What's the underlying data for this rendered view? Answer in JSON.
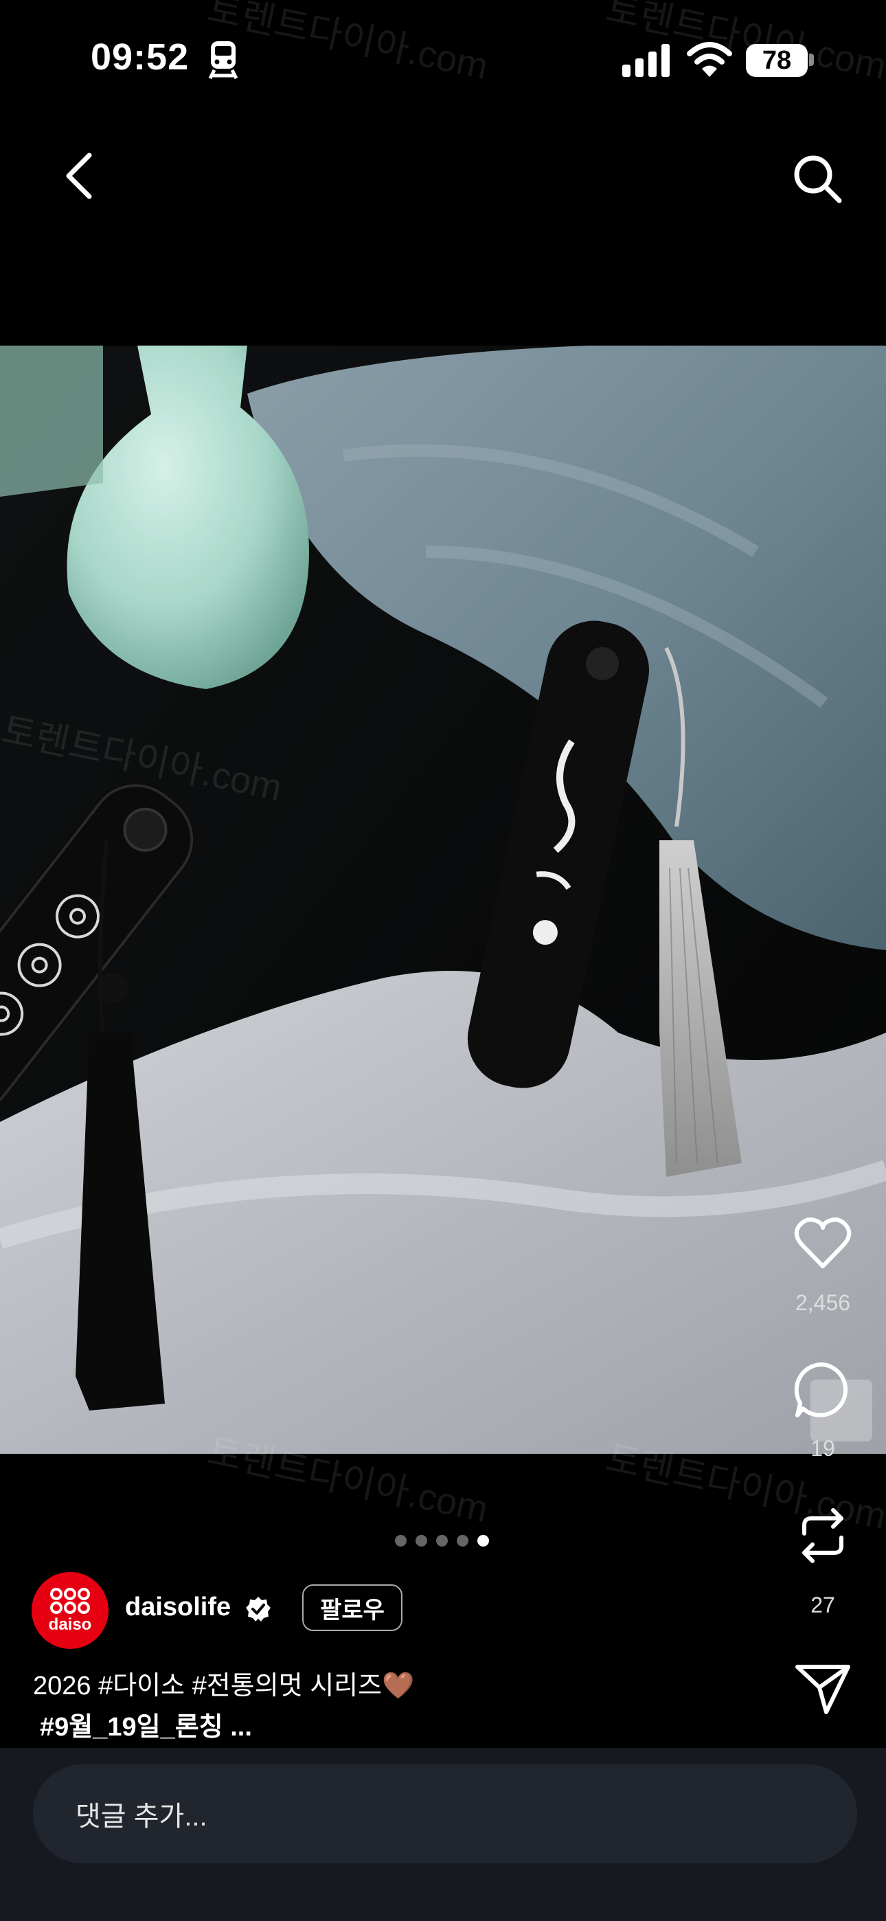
{
  "status_bar": {
    "time": "09:52",
    "battery": "78"
  },
  "post": {
    "username": "daisolife",
    "follow_label": "팔로우",
    "caption_line1": "2026 #다이소 #전통의멋 시리즈🤎",
    "caption_line2": "#9월_19일_론칭 ...",
    "likes": "2,456",
    "comments": "19",
    "reposts": "27",
    "page_count": 5,
    "current_page": 5
  },
  "avatar_logo_text": "daiso",
  "watermark_text": "토렌트다이아.com",
  "comment_placeholder": "댓글 추가..."
}
